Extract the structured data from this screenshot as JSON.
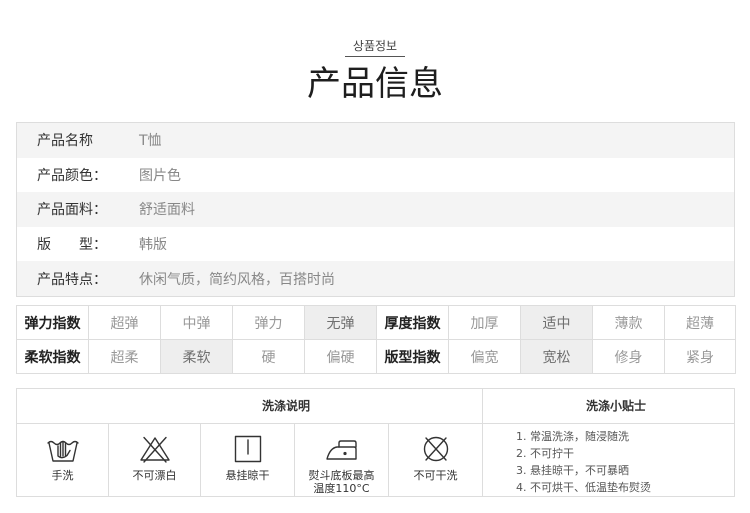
{
  "header": {
    "subtitle": "상품정보",
    "title": "产品信息"
  },
  "product_info": [
    {
      "label": "产品名称",
      "value": "T恤"
    },
    {
      "label": "产品颜色：",
      "value": "图片色"
    },
    {
      "label": "产品面料：",
      "value": "舒适面料"
    },
    {
      "label": "版　　型：",
      "value": "韩版"
    },
    {
      "label": "产品特点：",
      "value": "休闲气质，简约风格，百搭时尚"
    }
  ],
  "indices": {
    "rows": [
      {
        "groups": [
          {
            "label": "弹力指数",
            "options": [
              "超弹",
              "中弹",
              "弹力",
              "无弹"
            ],
            "selected_index": 3
          },
          {
            "label": "厚度指数",
            "options": [
              "加厚",
              "适中",
              "薄款",
              "超薄"
            ],
            "selected_index": 1
          }
        ]
      },
      {
        "groups": [
          {
            "label": "柔软指数",
            "options": [
              "超柔",
              "柔软",
              "硬",
              "偏硬"
            ],
            "selected_index": 1
          },
          {
            "label": "版型指数",
            "options": [
              "偏宽",
              "宽松",
              "修身",
              "紧身"
            ],
            "selected_index": 1
          }
        ]
      }
    ]
  },
  "care": {
    "instructions_title": "洗涤说明",
    "tips_title": "洗涤小贴士",
    "symbols": [
      {
        "icon": "hand-wash-icon",
        "label": "手洗"
      },
      {
        "icon": "no-bleach-icon",
        "label": "不可漂白"
      },
      {
        "icon": "hang-dry-icon",
        "label": "悬挂晾干"
      },
      {
        "icon": "iron-low-temp-icon",
        "label": "熨斗底板最高\n温度110°C"
      },
      {
        "icon": "no-dry-clean-icon",
        "label": "不可干洗"
      }
    ],
    "tips": [
      "1. 常温洗涤，随浸随洗",
      "2. 不可拧干",
      "3. 悬挂晾干，不可暴晒",
      "4. 不可烘干、低温垫布熨烫"
    ]
  },
  "colors": {
    "border": "#dddddd",
    "row_alt": "#f4f4f4",
    "selected": "#eeeeee",
    "label": "#333333",
    "value": "#888888",
    "option": "#999999"
  }
}
